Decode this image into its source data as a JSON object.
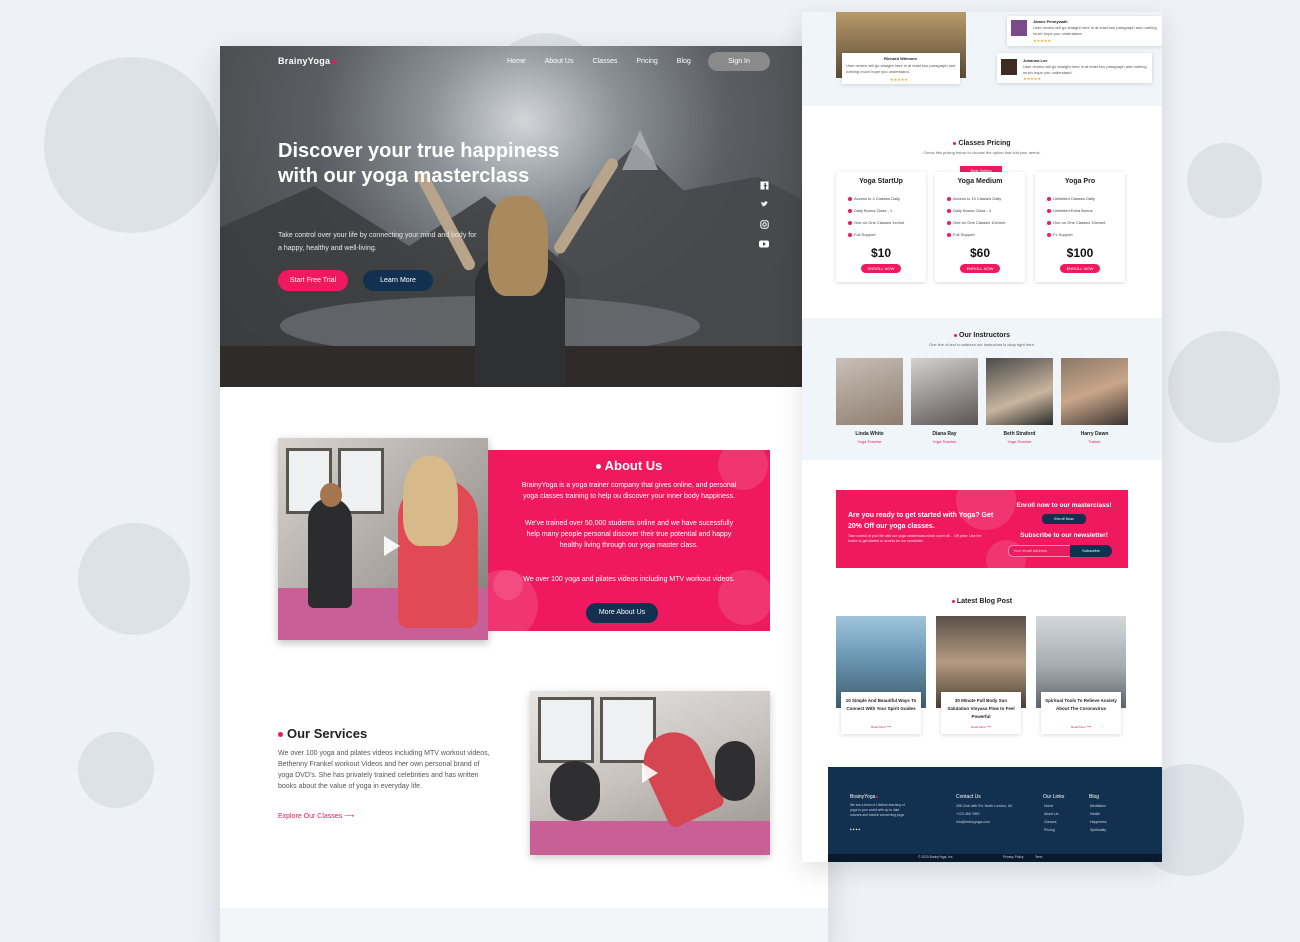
{
  "colors": {
    "accent": "#f0185f",
    "navy": "#12304f",
    "background": "#eef2f6"
  },
  "nav": {
    "logo": "BrainyYoga",
    "items": [
      "Home",
      "About Us",
      "Classes",
      "Pricing",
      "Blog"
    ],
    "signin": "Sign In"
  },
  "hero": {
    "title": "Discover your true happiness with our yoga masterclass",
    "subtitle": "Take control over your life  by connecting your mind and body for a happy, healthy and well-living.",
    "btn_primary": "Start Free Trial",
    "btn_secondary": "Learn More",
    "social_icons": [
      "facebook-icon",
      "twitter-icon",
      "instagram-icon",
      "youtube-icon"
    ]
  },
  "about": {
    "title": "About Us",
    "p1": "BrainyYoga is a yoga trainer company that gives online, and personal yoga classes training to help ou discover your inner body happiness.",
    "p2": "We've trained over 50,000 students online and we have sucessfully help many people personal discover their true potential and happy healthy living through our yoga master class.",
    "p3": "We over 100 yoga and pilates videos including MTV workout videos.",
    "button": "More About Us"
  },
  "services": {
    "title": "Our Services",
    "text": "We over 100 yoga and pilates videos including MTV workout videos, Bethenny Frankel workout Videos and her own personal brand of yoga DVD's. She has privately trained celebrities and has written books about the value of yoga in everyday life.",
    "link": "Explore Our Classes"
  },
  "testimonials": [
    {
      "name": "Richard Whimore",
      "text": "User review will go straight here in at least two paragraph and nothing much hope you understand.",
      "stars": "★★★★★"
    },
    {
      "name": "James Pennywath",
      "text": "User review will go straight here in at least two paragraph and nothing much hope you understand.",
      "stars": "★★★★★"
    },
    {
      "name": "Johanna Lee",
      "text": "User review will go straight here in at least two paragraph and nothing much hope you understand.",
      "stars": "★★★★★"
    }
  ],
  "pricing": {
    "title": "Classes Pricing",
    "subtitle": "Check this pricing below to choose the option that suit your needs.",
    "best_selling": "Best Selling",
    "plans": [
      {
        "name": "Yoga StartUp",
        "features": [
          "Access to 4 Classes Daily",
          "Daily Bonus Class - 1",
          "One on One Classes 1x/mnt",
          "Full Support"
        ],
        "price": "$10",
        "button": "ENROLL NOW"
      },
      {
        "name": "Yoga Medium",
        "features": [
          "Access to 10 Classes Daily",
          "Daily Bonus Class - 4",
          "One on One Classes 10x/mnt",
          "Full Support"
        ],
        "price": "$60",
        "button": "ENROLL NOW"
      },
      {
        "name": "Yoga Pro",
        "features": [
          "Unlimited Classes Daily",
          "Unlimited Extra Bonus",
          "One on One Classes 15x/mnt",
          "Fx Support"
        ],
        "price": "$100",
        "button": "ENROLL NOW"
      }
    ]
  },
  "instructors": {
    "title": "Our Instructors",
    "subtitle": "One line of text to address our instructors is okay right here.",
    "people": [
      {
        "name": "Linda White",
        "role": "Yoga Teacher"
      },
      {
        "name": "Diana Ray",
        "role": "Yoga Teacher"
      },
      {
        "name": "Beth Straford",
        "role": "Yoga Teacher"
      },
      {
        "name": "Harry Dawn",
        "role": "Trainer"
      }
    ]
  },
  "cta": {
    "heading": "Are you ready to get started with Yoga? Get 20% Off our yoga classes.",
    "text": "Take control of your life with our yoga masterclass which cover all ... Off price. Use the button to get started or access be our newsletter.",
    "enroll_heading": "Enroll now to our masterclass!",
    "enroll_button": "Enroll Now",
    "newsletter_heading": "Subscribe to our newsletter!",
    "email_placeholder": "Your email address",
    "subscribe_button": "Subscribe"
  },
  "blog": {
    "title": "Latest Blog Post",
    "posts": [
      {
        "title": "10 Simple And Beautiful Ways To Connect With Your Spirit Guides",
        "more": "Read More ⟶"
      },
      {
        "title": "30 Minute Full Body Sun Salutation Vinyasa Flow to Feel Powerful",
        "more": "Read More ⟶"
      },
      {
        "title": "Spiritual Tools To Relieve Anxiety About The Coronavirus",
        "more": "Read More ⟶"
      }
    ]
  },
  "footer": {
    "logo": "BrainyYoga",
    "description": "We are a team of Lifetime teaching of yoga to your world with up to date courses and tutorial concerning yoga.",
    "contact_title": "Contact Us",
    "contact": [
      "256 Club with Rd. North London, UK",
      "+123 456 7890",
      "info@brainyyoga.com"
    ],
    "links_title": "Our Links",
    "links": [
      "Home",
      "About Us",
      "Classes",
      "Pricing"
    ],
    "blog_title": "Blog",
    "blog_links": [
      "Meditation",
      "Health",
      "Happiness",
      "Spirituality"
    ],
    "copyright": "© 2020 BrainyYoga, Inc",
    "privacy": "Privacy Policy",
    "terms": "Term"
  }
}
